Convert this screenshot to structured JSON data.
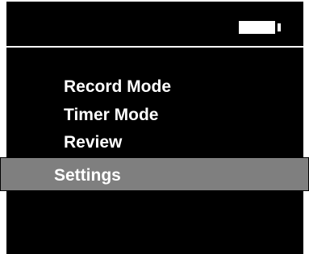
{
  "status_bar": {
    "battery_icon": "battery-full-icon",
    "battery_level": 1.0
  },
  "menu": {
    "items": [
      {
        "label": "Record Mode"
      },
      {
        "label": "Timer Mode"
      },
      {
        "label": "Review"
      },
      {
        "label": "Settings"
      }
    ],
    "selected_index": 3
  },
  "colors": {
    "screen_background": "#000000",
    "text": "#ffffff",
    "highlight": "#7f7f7f"
  }
}
